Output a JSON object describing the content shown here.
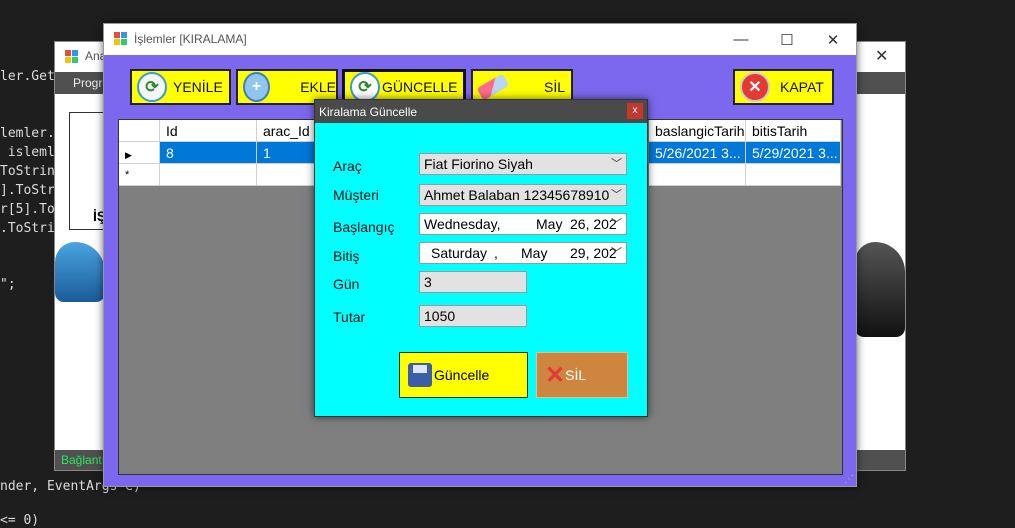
{
  "code_editor": {
    "lines": [
      "ler.Get",
      "lemler.",
      " islemle",
      "ToStrin",
      "].ToStr",
      "r[5].To",
      ".ToStri",
      "\";",
      "nder, EventArgs e)",
      "<= 0)"
    ]
  },
  "back_window": {
    "title": "Ana",
    "menu": "Progra",
    "status": "Bağlantı",
    "partial_label": "İŞ"
  },
  "front_window": {
    "title": "İşlemler [KIRALAMA]",
    "toolbar": {
      "refresh": "YENİLE",
      "add": "EKLE",
      "update": "GÜNCELLE",
      "delete": "SİL",
      "close": "KAPAT"
    },
    "grid": {
      "columns": [
        "Id",
        "arac_Id",
        "baslangicTarih",
        "bitisTarih"
      ],
      "rows": [
        {
          "id": "8",
          "arac_id": "1",
          "baslangic": "5/26/2021 3...",
          "bitis": "5/29/2021 3..."
        }
      ],
      "new_row_marker": "*"
    }
  },
  "dialog": {
    "title": "Kiralama Güncelle",
    "close": "x",
    "labels": {
      "arac": "Araç",
      "musteri": "Müşteri",
      "baslangic": "Başlangıç",
      "bitis": "Bitiş",
      "gun": "Gün",
      "tutar": "Tutar"
    },
    "values": {
      "arac": "Fiat Fiorino Siyah",
      "musteri": "Ahmet Balaban 12345678910",
      "baslangic_day": "Wednesday,",
      "baslangic_month": "May",
      "baslangic_date": "26, 202",
      "bitis_day": "Saturday",
      "bitis_comma": ",",
      "bitis_month": "May",
      "bitis_date": "29, 202",
      "gun": "3",
      "tutar": "1050"
    },
    "buttons": {
      "update": "Güncelle",
      "delete": "SİL"
    }
  },
  "colors": {
    "form_border": "#7b68ee",
    "dialog_bg": "#00ffff",
    "toolbar_button": "#ffff00",
    "delete_button": "#cd853f",
    "selected_row": "#0078d7"
  }
}
